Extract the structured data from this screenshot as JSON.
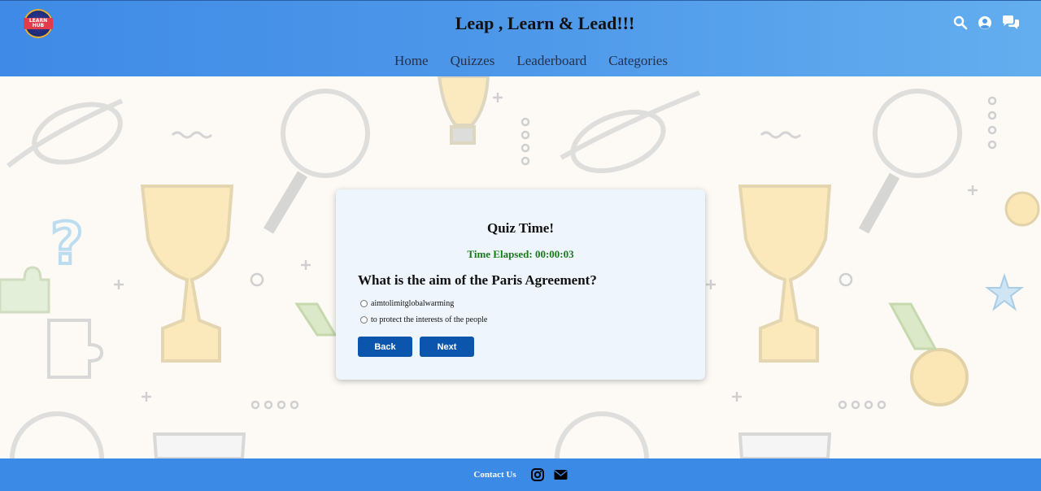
{
  "header": {
    "logo_text": "LEARN HUB",
    "title": "Leap , Learn & Lead!!!",
    "nav": [
      {
        "label": "Home"
      },
      {
        "label": "Quizzes"
      },
      {
        "label": "Leaderboard"
      },
      {
        "label": "Categories"
      }
    ],
    "icons": [
      "search-icon",
      "user-account-icon",
      "chat-icon"
    ]
  },
  "quiz": {
    "title": "Quiz Time!",
    "timer": "Time Elapsed: 00:00:03",
    "question": "What is the aim of the Paris Agreement?",
    "options": [
      {
        "label": "aimtolimitglobalwarming",
        "selected": false
      },
      {
        "label": "to protect the interests of the people",
        "selected": false
      }
    ],
    "back_label": "Back",
    "next_label": "Next"
  },
  "footer": {
    "contact_label": "Contact Us",
    "icons": [
      "instagram-icon",
      "email-icon"
    ]
  },
  "colors": {
    "header_gradient_start": "#3f8ae6",
    "header_gradient_end": "#63aeee",
    "button": "#0c55ad",
    "timer": "#1a7a1a",
    "card": "#eef5fd",
    "footer": "#3b8ae6"
  }
}
